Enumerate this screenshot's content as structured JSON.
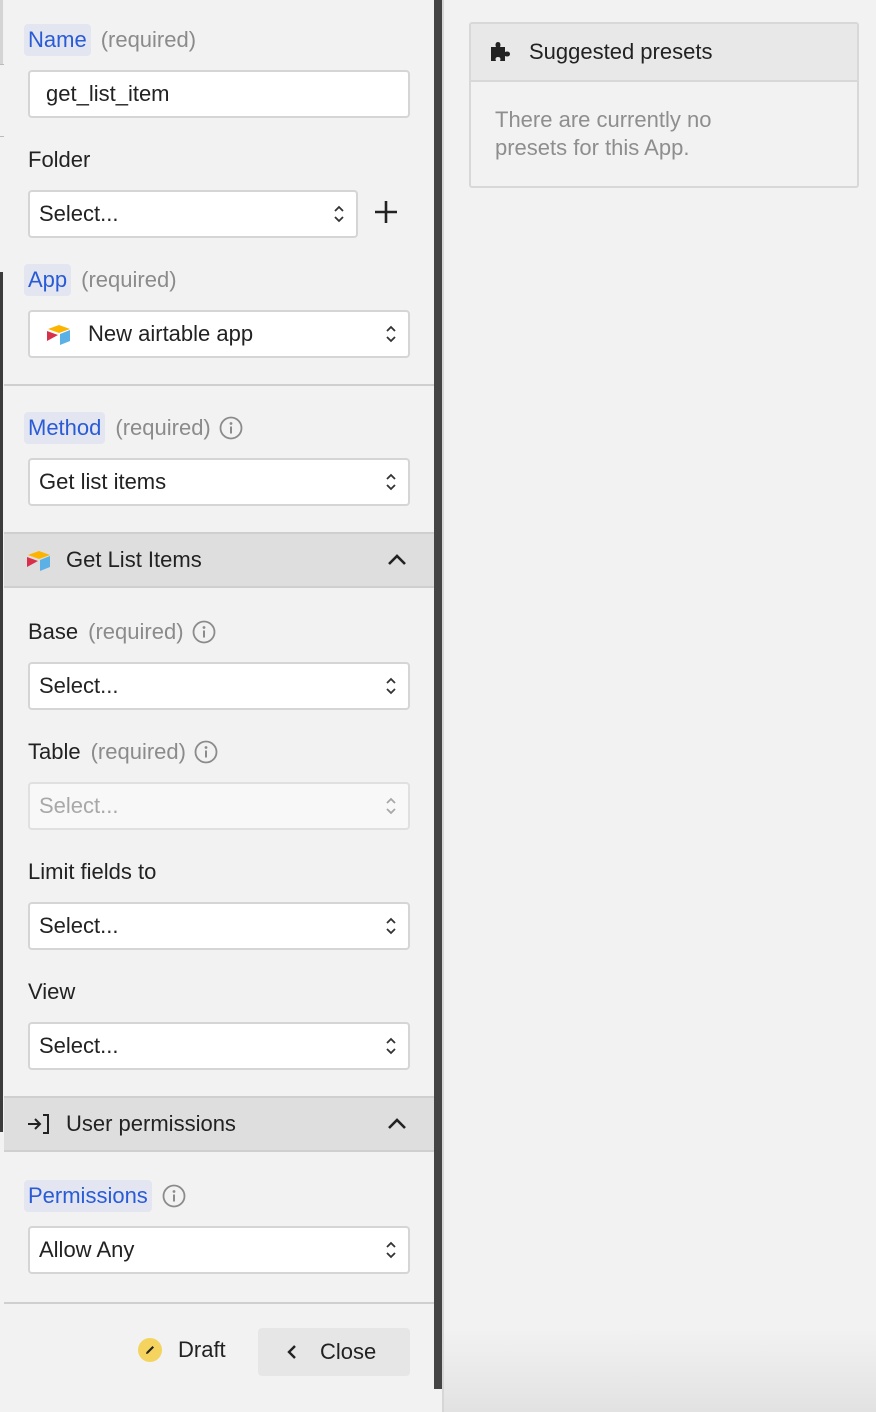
{
  "form": {
    "name": {
      "label": "Name",
      "required": "(required)",
      "value": "get_list_item"
    },
    "folder": {
      "label": "Folder",
      "value": "Select...",
      "add_icon": "plus-icon"
    },
    "app": {
      "label": "App",
      "required": "(required)",
      "value": "New airtable app",
      "icon": "airtable-logo-icon"
    },
    "method": {
      "label": "Method",
      "required": "(required)",
      "value": "Get list items",
      "info_icon": "info-icon"
    },
    "section_get_list_items": {
      "title": "Get List Items",
      "icon": "airtable-logo-icon",
      "expanded": true,
      "fields": {
        "base": {
          "label": "Base",
          "required": "(required)",
          "value": "Select..."
        },
        "table": {
          "label": "Table",
          "required": "(required)",
          "value": "Select...",
          "disabled": true
        },
        "limit_fields": {
          "label": "Limit fields to",
          "value": "Select..."
        },
        "view": {
          "label": "View",
          "value": "Select..."
        }
      }
    },
    "section_user_permissions": {
      "title": "User permissions",
      "icon": "sign-in-icon",
      "expanded": true,
      "fields": {
        "permissions": {
          "label": "Permissions",
          "value": "Allow Any"
        }
      }
    }
  },
  "footer": {
    "status_label": "Draft",
    "status_icon": "pencil-icon",
    "close_label": "Close"
  },
  "presets": {
    "title": "Suggested presets",
    "icon": "puzzle-icon",
    "empty_message": "There are currently no presets for this App."
  },
  "colors": {
    "accent": "#2a5bd7",
    "chip_bg": "#e3e6f0",
    "draft": "#f4d35e",
    "airtable_yellow": "#fcb400",
    "airtable_red": "#d9304a",
    "airtable_blue": "#5bb0e6"
  }
}
